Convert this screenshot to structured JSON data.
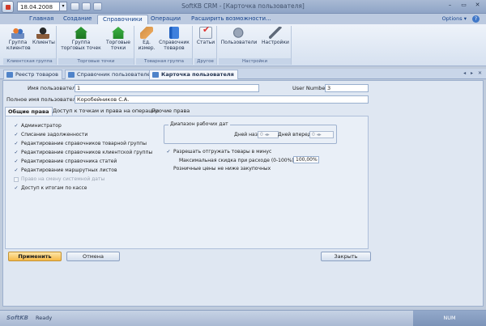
{
  "titlebar": {
    "date": "18.04.2008",
    "title": "SoftKB CRM - [Карточка пользователя]",
    "window_controls": [
      "–",
      "▭",
      "✕"
    ]
  },
  "ribbon": {
    "tabs": [
      "Главная",
      "Создание",
      "Справочники",
      "Операции",
      "Расширить возможности..."
    ],
    "active_tab": "Справочники",
    "options": "Options",
    "groups": [
      {
        "label": "Клиентская группа",
        "buttons": [
          "Группа клиентов",
          "Клиенты"
        ]
      },
      {
        "label": "Торговые точки",
        "buttons": [
          "Группа торговых точек",
          "Торговые точки"
        ]
      },
      {
        "label": "Товарная группа",
        "buttons": [
          "Ед. измер.",
          "Справочник товаров"
        ]
      },
      {
        "label": "Другое",
        "buttons": [
          "Статьи"
        ]
      },
      {
        "label": "Настройки",
        "buttons": [
          "Пользователи",
          "Настройки"
        ]
      }
    ]
  },
  "doc_tabs": [
    "Реестр товаров",
    "Справочник пользователей",
    "Карточка пользователя"
  ],
  "doc_nav": "◂ ▸ ✕",
  "form": {
    "username_label": "Имя пользователя",
    "username_value": "1",
    "user_number_label": "User Number",
    "user_number_value": "3",
    "fullname_label": "Полное имя пользователя",
    "fullname_value": "Коробейников С.А.",
    "inner_tabs": [
      "Общие права",
      "Доступ к точкам и права на операции",
      "Прочие права"
    ],
    "permissions": [
      {
        "label": "Администратор",
        "checked": true,
        "enabled": true
      },
      {
        "label": "Списание задолженности",
        "checked": true,
        "enabled": true
      },
      {
        "label": "Редактирование справочников товарной группы",
        "checked": true,
        "enabled": true
      },
      {
        "label": "Редактирование справочников клиентской группы",
        "checked": true,
        "enabled": true
      },
      {
        "label": "Редактирование справочника статей",
        "checked": true,
        "enabled": true
      },
      {
        "label": "Редактирование маршрутных листов",
        "checked": true,
        "enabled": true
      },
      {
        "label": "Право на смену системной даты",
        "checked": false,
        "enabled": false
      },
      {
        "label": "Доступ к итогам по кассе",
        "checked": true,
        "enabled": true
      }
    ],
    "range": {
      "legend": "Диапазон рабочих дат",
      "days_back_label": "Дней назад",
      "days_back_value": "0",
      "days_forward_label": "Дней вперед",
      "days_forward_value": "0"
    },
    "allow_minus_label": "Разрешать отгружать товары в минус",
    "allow_minus_checked": true,
    "max_discount_label": "Максимальная скидка при расходе (0-100%)",
    "max_discount_value": "100,00%",
    "retail_label": "Розничные цены не ниже закупочных",
    "retail_checked": false
  },
  "buttons": {
    "apply": "Применить",
    "cancel": "Отмена",
    "close": "Закрыть"
  },
  "statusbar": {
    "brand": "SoftKB",
    "ready": "Ready",
    "num": "NUM"
  }
}
